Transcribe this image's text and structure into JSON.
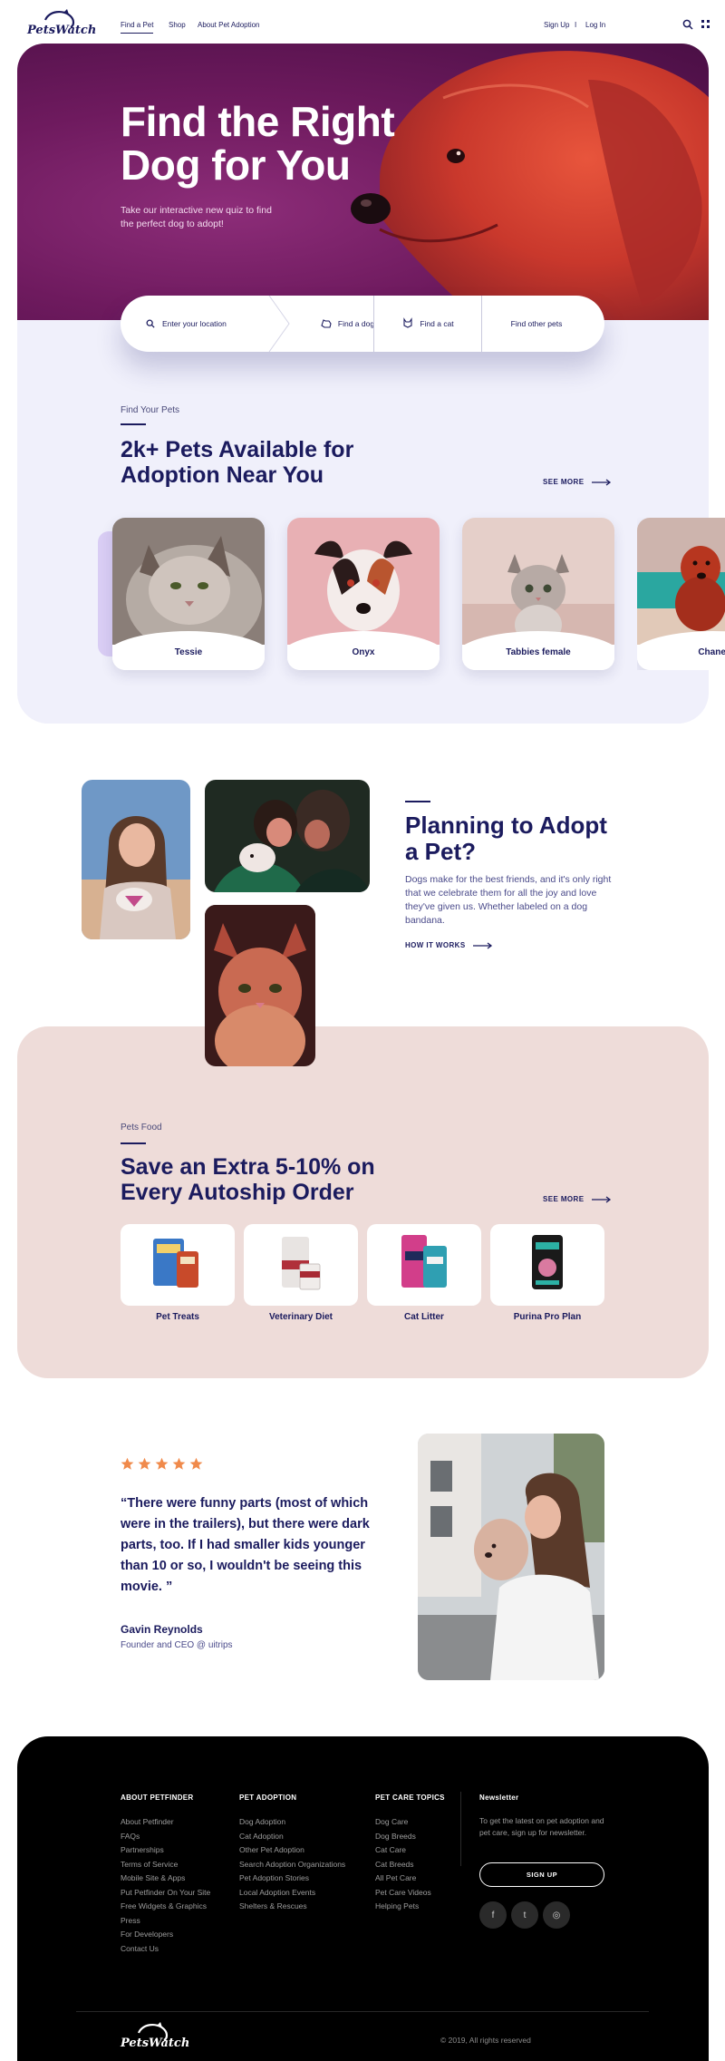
{
  "brand": {
    "name": "PetsWatch"
  },
  "nav": {
    "items": [
      "Find a Pet",
      "Shop",
      "About Pet Adoption"
    ],
    "signup": "Sign Up",
    "separator": "I",
    "login": "Log In"
  },
  "hero": {
    "title_line1": "Find the Right",
    "title_line2": "Dog for You",
    "subtitle_line1": "Take our interactive new quiz to find",
    "subtitle_line2": "the perfect dog to adopt!"
  },
  "search": {
    "location_placeholder": "Enter your location",
    "find_dog": "Find a dog",
    "find_cat": "Find a cat",
    "find_other": "Find other pets"
  },
  "pets_section": {
    "kicker": "Find Your Pets",
    "title_line1": "2k+ Pets Available for",
    "title_line2": "Adoption Near You",
    "see_more": "SEE MORE",
    "pets": [
      {
        "name": "Tessie"
      },
      {
        "name": "Onyx"
      },
      {
        "name": "Tabbies female"
      },
      {
        "name": "Chanel"
      }
    ]
  },
  "planning": {
    "title_line1": "Planning to Adopt",
    "title_line2": "a Pet?",
    "body": "Dogs make for the best friends, and it's only right that we celebrate them for all the joy and love they've given us. Whether labeled on a dog bandana.",
    "link": "HOW IT WORKS"
  },
  "food_section": {
    "kicker": "Pets Food",
    "title_line1": "Save an Extra 5-10% on",
    "title_line2": "Every Autoship Order",
    "see_more": "SEE MORE",
    "products": [
      {
        "name": "Pet Treats"
      },
      {
        "name": "Veterinary Diet"
      },
      {
        "name": "Cat Litter"
      },
      {
        "name": "Purina Pro Plan"
      }
    ]
  },
  "testimonial": {
    "rating": 5,
    "quote": "“There were funny parts (most of which were in the trailers), but there were dark parts, too. If I had smaller kids younger than 10 or so, I wouldn't be seeing this movie. ”",
    "author": "Gavin Reynolds",
    "role": "Founder and CEO @ uitrips"
  },
  "footer": {
    "columns": [
      {
        "heading": "ABOUT PETFINDER",
        "links": [
          "About Petfinder",
          "FAQs",
          "Partnerships",
          "Terms of Service",
          "Mobile Site & Apps",
          "Put Petfinder On Your Site",
          "Free Widgets & Graphics",
          "Press",
          "For Developers",
          "Contact Us"
        ]
      },
      {
        "heading": "PET ADOPTION",
        "links": [
          "Dog Adoption",
          "Cat Adoption",
          "Other Pet Adoption",
          "Search Adoption Organizations",
          "Pet Adoption Stories",
          "Local Adoption Events",
          "Shelters & Rescues"
        ]
      },
      {
        "heading": "PET CARE TOPICS",
        "links": [
          "Dog Care",
          "Dog Breeds",
          "Cat Care",
          "Cat Breeds",
          "All Pet Care",
          "Pet Care Videos",
          "Helping Pets"
        ]
      }
    ],
    "newsletter": {
      "heading": "Newsletter",
      "text": "To get the latest on pet adoption and pet care, sign up for newsletter.",
      "button": "SIGN UP"
    },
    "social": [
      {
        "icon": "facebook-icon",
        "glyph": "f"
      },
      {
        "icon": "twitter-icon",
        "glyph": "t"
      },
      {
        "icon": "dribbble-icon",
        "glyph": "◎"
      }
    ],
    "copyright": "© 2019, All rights reserved"
  },
  "colors": {
    "navy": "#1b1b5e",
    "hero_purple": "#6e1a5e",
    "light_section": "#f0f0fb",
    "food_section": "#eedcd9",
    "star": "#f08a4b",
    "footer": "#000000"
  }
}
